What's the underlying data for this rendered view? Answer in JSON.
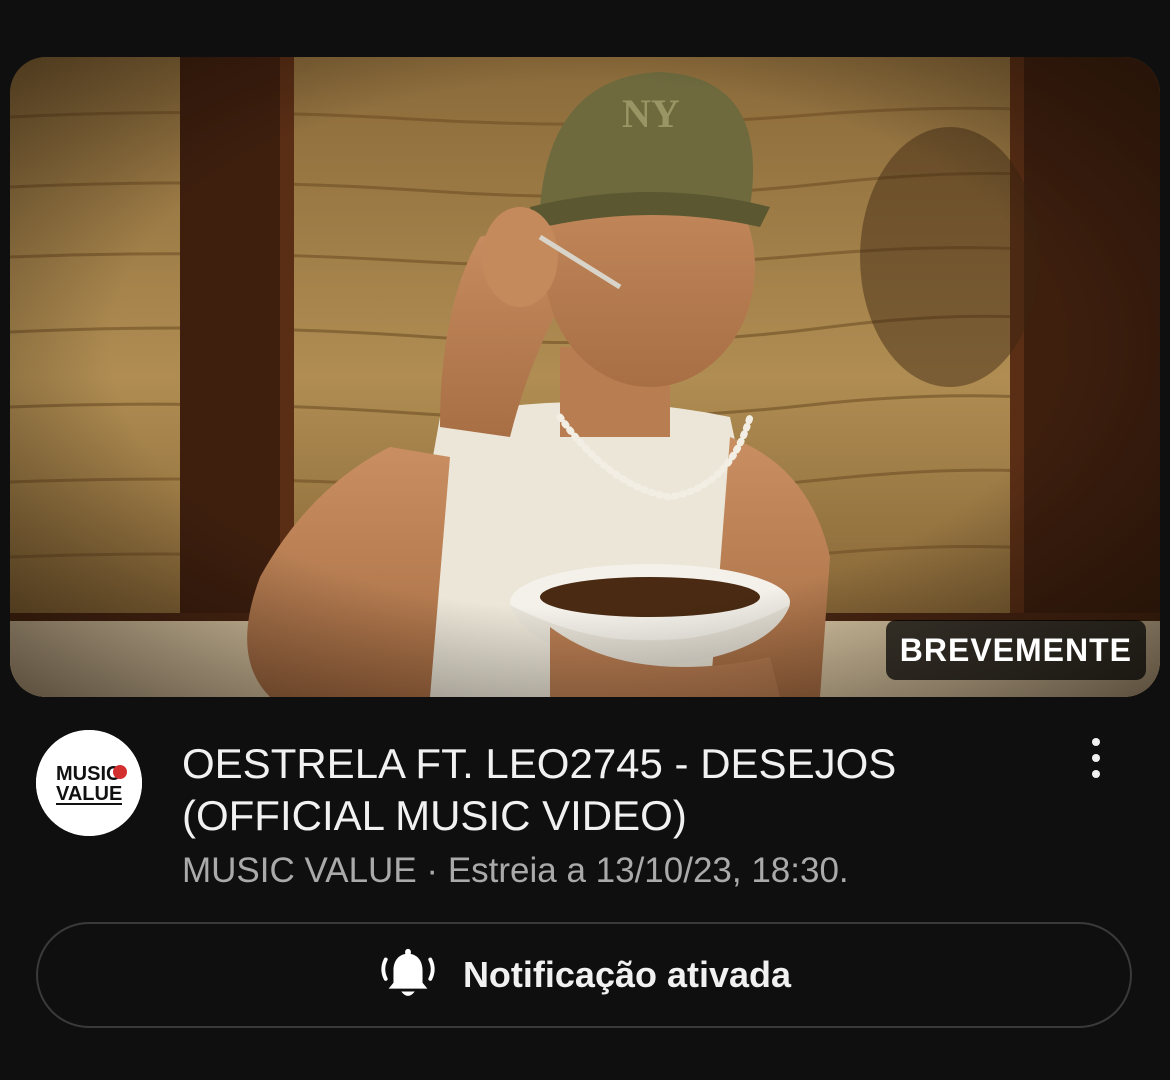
{
  "video": {
    "badge": "BREVEMENTE",
    "title_line1": "OESTRELA FT. LEO2745 - DESEJOS",
    "title_line2": "(OFFICIAL MUSIC VIDEO)",
    "channel": "MUSIC VALUE",
    "separator": "·",
    "premiere": "Estreia a 13/10/23, 18:30."
  },
  "channel_avatar": {
    "logo_line1": "MUSIC",
    "logo_line2": "VALUE"
  },
  "notify_button": {
    "label": "Notificação ativada",
    "icon": "bell-ringing-icon"
  },
  "more_menu": {
    "icon": "more-vertical-icon"
  },
  "colors": {
    "background": "#0f0f0f",
    "text_primary": "#f1f1f1",
    "text_secondary": "#aaaaaa",
    "button_border": "#3a3a3a",
    "brand_red": "#d32f2f"
  }
}
